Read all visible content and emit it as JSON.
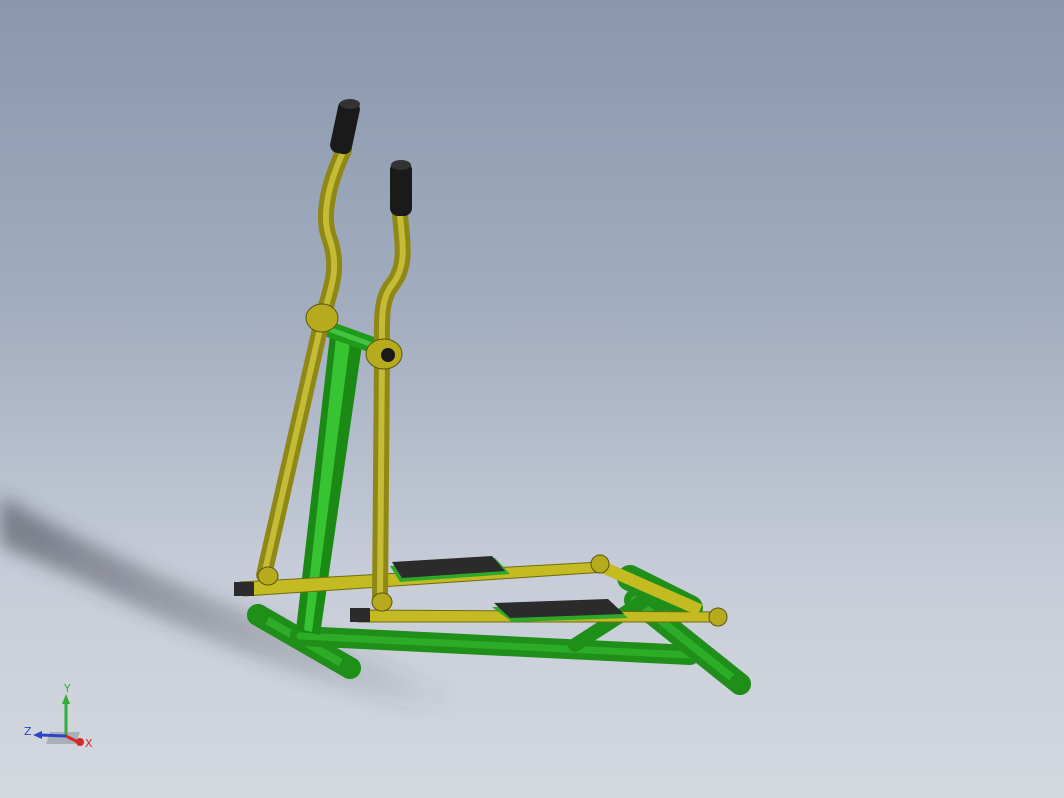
{
  "viewport": {
    "background_top": "#8996ac",
    "background_bottom": "#d4d8df"
  },
  "model": {
    "description_icon": "elliptical-trainer-model",
    "colors": {
      "frame_green": "#1f9a1a",
      "frame_green_light": "#3fd23a",
      "arm_yellow": "#b5ab1c",
      "arm_yellow_light": "#e6e04a",
      "grip_black": "#1a1a1a",
      "pedal_dark": "#2b2b2b",
      "pedal_green": "#2fa82a"
    }
  },
  "triad": {
    "x_label": "X",
    "y_label": "Y",
    "z_label": "Z",
    "x_color": "#d42a2a",
    "y_color": "#2fae3a",
    "z_color": "#2a45c8"
  }
}
